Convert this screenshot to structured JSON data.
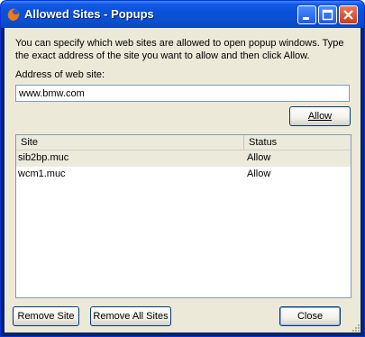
{
  "window": {
    "title": "Allowed Sites - Popups",
    "controls": {
      "minimize": "minimize-icon",
      "maximize": "maximize-icon",
      "close": "close-icon"
    }
  },
  "description": "You can specify which web sites are allowed to open popup windows. Type the exact address of the site you want to allow and then click Allow.",
  "address": {
    "label": "Address of web site:",
    "value": "www.bmw.com"
  },
  "buttons": {
    "allow": "Allow",
    "remove_site": "Remove Site",
    "remove_all": "Remove All Sites",
    "close": "Close"
  },
  "table": {
    "columns": [
      "Site",
      "Status"
    ],
    "rows": [
      {
        "site": "sib2bp.muc",
        "status": "Allow"
      },
      {
        "site": "wcm1.muc",
        "status": "Allow"
      }
    ]
  },
  "colors": {
    "titlebar": "#0a4fcf",
    "dialog_bg": "#ece9d8",
    "selected_row": "#ebeadb"
  }
}
